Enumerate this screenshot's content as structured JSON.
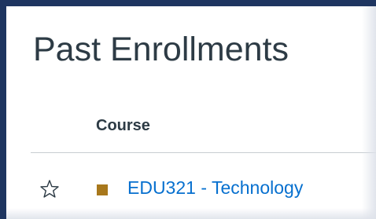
{
  "page": {
    "title": "Past Enrollments"
  },
  "table": {
    "columns": [
      "Course"
    ],
    "rows": [
      {
        "favorite_icon": "star-outline-icon",
        "color": "#a8781c",
        "course": "EDU321 - Technology"
      }
    ]
  },
  "colors": {
    "frame": "#1e3560",
    "link": "#0770cf",
    "text": "#2d3b45"
  }
}
